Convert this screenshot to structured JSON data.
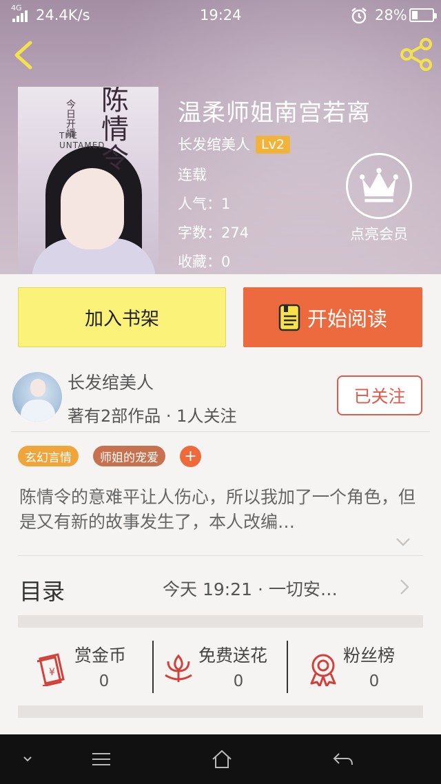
{
  "status_bar": {
    "network": "4G",
    "speed": "24.4K/s",
    "time": "19:24",
    "battery_percent": "28%",
    "battery_level": 0.28
  },
  "header": {
    "back_icon": "chevron-left-icon",
    "share_icon": "share-icon"
  },
  "book": {
    "title": "温柔师姐南宫若离",
    "author": "长发绾美人",
    "level": "Lv2",
    "status": "连载",
    "popularity": "人气：1",
    "word_count": "字数：274",
    "favorites": "收藏：0",
    "cover": {
      "top_text": "今日开播",
      "title_glyph": "陈情令",
      "subtitle": "THE UNTAMED"
    }
  },
  "vip": {
    "icon": "crown-icon",
    "label": "点亮会员"
  },
  "buttons": {
    "add_shelf": "加入书架",
    "start_reading": "开始阅读"
  },
  "author_card": {
    "name": "长发绾美人",
    "stats": "著有2部作品 · 1人关注",
    "follow_label": "已关注"
  },
  "tags": [
    {
      "label": "玄幻言情",
      "color": "#f0a53a"
    },
    {
      "label": "师姐的宠爱",
      "color": "#c8714f"
    }
  ],
  "tag_add": "+",
  "description": "陈情令的意难平让人伤心，所以我加了一个角色，但是又有新的故事发生了，本人改编…",
  "directory": {
    "label": "目录",
    "latest": "今天 19:21 · 一切安…"
  },
  "actions": [
    {
      "label": "赏金币",
      "value": "0",
      "icon": "coin-envelope-icon"
    },
    {
      "label": "免费送花",
      "value": "0",
      "icon": "flower-icon"
    },
    {
      "label": "粉丝榜",
      "value": "0",
      "icon": "medal-icon"
    }
  ],
  "colors": {
    "accent_orange": "#ec6a3e",
    "shelf_yellow": "#fbf27a",
    "follow_red": "#e05a4a",
    "lv_badge": "#f2b33a"
  }
}
